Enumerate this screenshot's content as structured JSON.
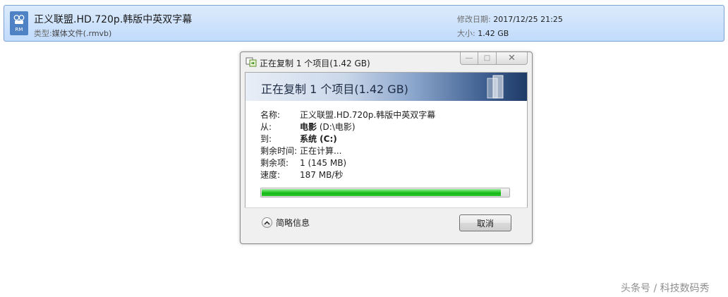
{
  "file": {
    "name": "正义联盟.HD.720p.韩版中英双字幕",
    "icon": "rm-video-file-icon",
    "icon_tag": "RM",
    "type_label": "类型:",
    "type_value": "媒体文件(.rmvb)",
    "date_label": "修改日期:",
    "date_value": "2017/12/25 21:25",
    "size_label": "大小:",
    "size_value": "1.42 GB"
  },
  "dialog": {
    "title": "正在复制 1 个项目(1.42 GB)",
    "banner": "正在复制 1 个项目(1.42 GB)",
    "window_buttons": {
      "minimize": "minimize-icon",
      "maximize": "maximize-icon",
      "close": "close-icon"
    },
    "details": {
      "name_label": "名称:",
      "name_value": "正义联盟.HD.720p.韩版中英双字幕",
      "from_label": "从:",
      "from_strong": "电影",
      "from_rest": " (D:\\电影)",
      "to_label": "到:",
      "to_value": "系统 (C:)",
      "time_left_label": "剩余时间:",
      "time_left_value": "正在计算...",
      "items_left_label": "剩余项:",
      "items_left_value": "1 (145 MB)",
      "speed_label": "速度:",
      "speed_value": "187 MB/秒"
    },
    "progress_fraction": 0.97,
    "progress_color": "#12b612",
    "more_info_label": "简略信息",
    "cancel_label": "取消"
  },
  "watermark": "头条号 / 科技数码秀",
  "colors": {
    "selection_bg": "#c1dbfc",
    "selection_border": "#7da2ce",
    "banner_dark": "#1f3b67",
    "dialog_bg": "#f0f0f0"
  }
}
